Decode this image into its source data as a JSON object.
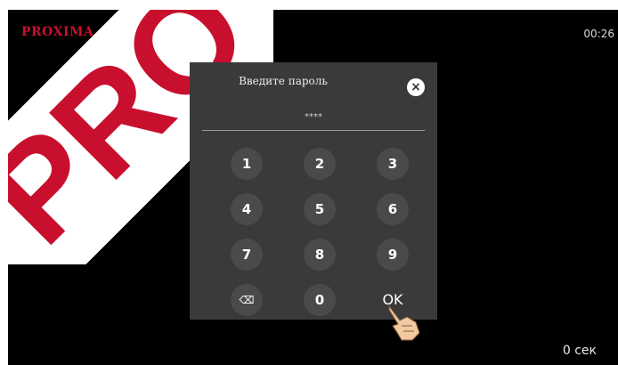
{
  "app": {
    "brand": "PROXIMA",
    "clock": "00:26",
    "countdown": "0 сек"
  },
  "watermark": {
    "text": "PRO",
    "color": "#c8102e"
  },
  "dialog": {
    "title": "Введите пароль",
    "close_symbol": "×",
    "masked_password": "****"
  },
  "keypad": {
    "keys": [
      "1",
      "2",
      "3",
      "4",
      "5",
      "6",
      "7",
      "8",
      "9",
      "⌫",
      "0",
      "OK"
    ],
    "backspace_icon": "backspace-icon"
  },
  "colors": {
    "brand": "#c8102e",
    "dialog_bg": "#3a3a3a",
    "key_bg": "#4a4a4a"
  }
}
